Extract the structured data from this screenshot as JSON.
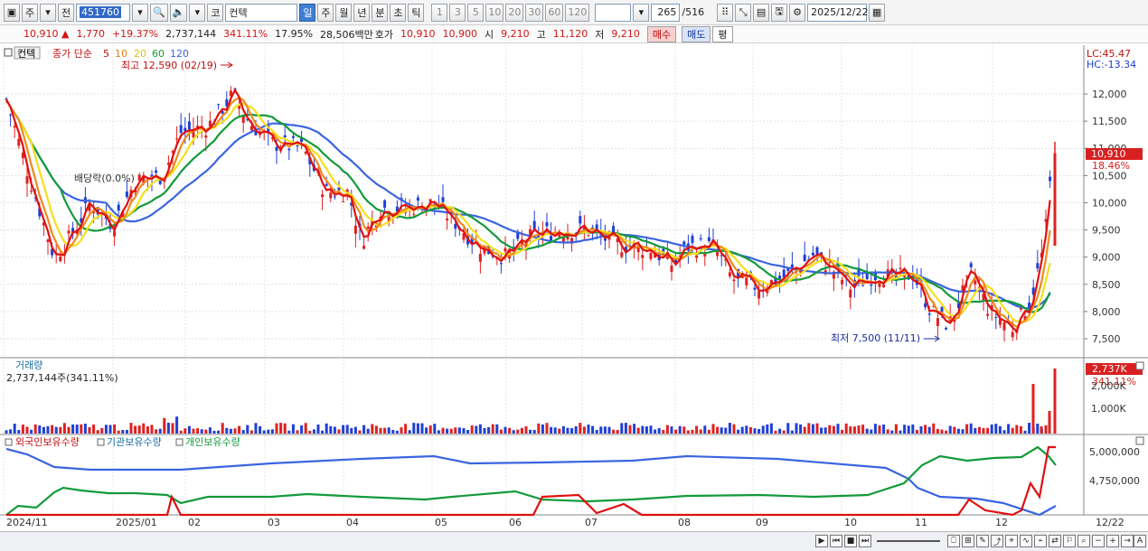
{
  "toolbar": {
    "period_sel": "주",
    "type_sel": "전",
    "code": "451760",
    "name": "컨텍",
    "periods": [
      "일",
      "주",
      "월",
      "년",
      "분",
      "초",
      "틱"
    ],
    "nums": [
      "1",
      "3",
      "5",
      "10",
      "20",
      "30",
      "60",
      "120"
    ],
    "count": "265",
    "total": "/516",
    "date": "2025/12/22"
  },
  "quote": {
    "price": "10,910",
    "change": "1,770",
    "rate": "+19.37%",
    "volume": "2,737,144",
    "vol_ratio": "341.11%",
    "turnover": "17.95%",
    "amount": "28,506백만",
    "ask_label": "호가",
    "ask1": "10,910",
    "ask2": "10,900",
    "open_label": "시",
    "open": "9,210",
    "high_label": "고",
    "high": "11,120",
    "low_label": "저",
    "low": "9,210",
    "buy": "매수",
    "sell": "매도",
    "avg": "평"
  },
  "legend": {
    "name": "컨텍",
    "price_label": "종가 단순",
    "ma5": "5",
    "ma10": "10",
    "ma20": "20",
    "ma60": "60",
    "ma120": "120",
    "high_note": "최고 12,590 (02/19)",
    "low_note": "최저 7,500 (11/11)",
    "div_note": "배당락(0.0%)",
    "lc": "LC:45.47",
    "hc": "HC:-13.34",
    "cur_price": "10,910",
    "cur_rate": "18.46%"
  },
  "volume": {
    "title": "거래량",
    "value": "2,737,144주(341.11%)",
    "badge": "2,737K",
    "badge_rate": "341.11%",
    "axis": [
      "2,000K",
      "1,000K"
    ]
  },
  "holders": {
    "foreign": "외국인보유수량",
    "inst": "기관보유수량",
    "indiv": "개인보유수량",
    "axis": [
      "5,000,000",
      "4,750,000"
    ]
  },
  "price_axis": [
    "12,000",
    "11,500",
    "11,000",
    "10,500",
    "10,000",
    "9,500",
    "9,000",
    "8,500",
    "8,000",
    "7,500"
  ],
  "x_axis": [
    "2024/11",
    "2025/01",
    "02",
    "03",
    "04",
    "05",
    "06",
    "07",
    "08",
    "09",
    "10",
    "11",
    "12",
    "12/22"
  ],
  "colors": {
    "up": "#e02020",
    "down": "#1f3fd6",
    "ma5": "#e01010",
    "ma10": "#f08a1c",
    "ma20": "#f4e01c",
    "ma60": "#139a3a",
    "ma120": "#3a64e0"
  }
}
